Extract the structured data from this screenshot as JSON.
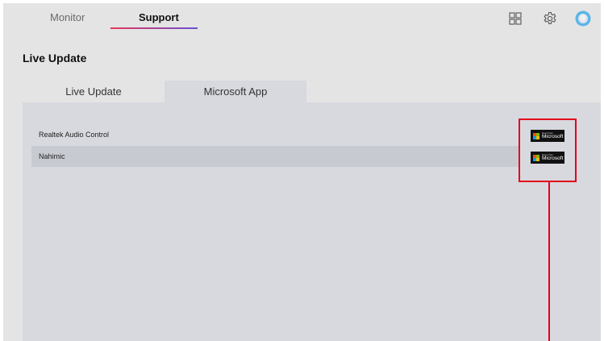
{
  "nav": {
    "tabs": [
      {
        "label": "Monitor",
        "active": false
      },
      {
        "label": "Support",
        "active": true
      }
    ],
    "icons": [
      "grid-icon",
      "gear-icon",
      "avatar-icon"
    ]
  },
  "section": {
    "title": "Live Update"
  },
  "subtabs": [
    {
      "label": "Live Update",
      "active": false
    },
    {
      "label": "Microsoft App",
      "active": true
    }
  ],
  "apps": [
    {
      "name": "Realtek Audio Control",
      "badge_small": "Get it from",
      "badge_big": "Microsoft"
    },
    {
      "name": "Nahimic",
      "badge_small": "Get it from",
      "badge_big": "Microsoft"
    }
  ],
  "colors": {
    "accent_red": "#e53a57",
    "accent_purple": "#6c4fd6",
    "callout": "#e3001b",
    "avatar": "#5ab6e8"
  }
}
